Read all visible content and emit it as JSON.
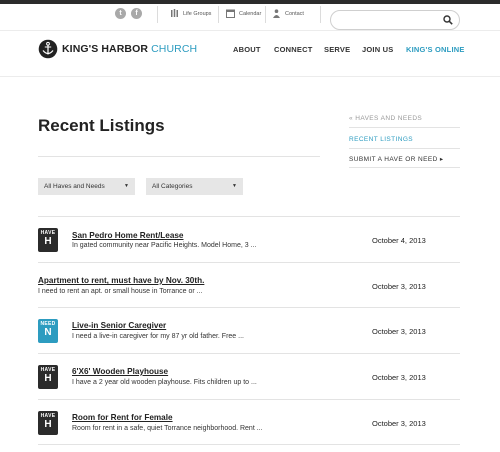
{
  "utility": {
    "social": [
      {
        "icon": "twitter-icon",
        "glyph": "t"
      },
      {
        "icon": "facebook-icon",
        "glyph": "f"
      }
    ],
    "life_groups": "Life Groups",
    "calendar": "Calendar",
    "contact": "Contact",
    "search_placeholder": ""
  },
  "brand": {
    "name_bold": "KING'S HARBOR",
    "name_light": "CHURCH",
    "accent_color": "#2d9cc0"
  },
  "nav": {
    "about": "ABOUT",
    "connect": "CONNECT",
    "serve": "SERVE",
    "join_us": "JOIN US",
    "kings_online": "KING'S ONLINE"
  },
  "page_title": "Recent Listings",
  "sidebar": {
    "back": "« HAVES AND NEEDS",
    "current": "RECENT LISTINGS",
    "submit": "SUBMIT A HAVE OR NEED ▸"
  },
  "filters": {
    "type_selected": "All Haves and Needs",
    "category_selected": "All Categories"
  },
  "listings": [
    {
      "badge_type": "HAVE",
      "badge_letter": "H",
      "title": "San Pedro Home Rent/Lease",
      "desc": "In gated community near Pacific Heights. Model Home, 3 ...",
      "date": "October 4, 2013"
    },
    {
      "badge_type": "",
      "badge_letter": "",
      "title": "Apartment to rent, must have by Nov. 30th.",
      "desc": "I need to rent an apt. or small house in Torrance or ...",
      "date": "October 3, 2013"
    },
    {
      "badge_type": "NEED",
      "badge_letter": "N",
      "title": "Live-in Senior Caregiver",
      "desc": "I need a live-in caregiver for my 87 yr old father. Free ...",
      "date": "October 3, 2013"
    },
    {
      "badge_type": "HAVE",
      "badge_letter": "H",
      "title": "6'X6' Wooden Playhouse",
      "desc": "I have a 2 year old wooden playhouse. Fits children up to ...",
      "date": "October 3, 2013"
    },
    {
      "badge_type": "HAVE",
      "badge_letter": "H",
      "title": "Room for Rent for Female",
      "desc": "Room for rent in a safe, quiet Torrance neighborhood. Rent ...",
      "date": "October 3, 2013"
    }
  ]
}
